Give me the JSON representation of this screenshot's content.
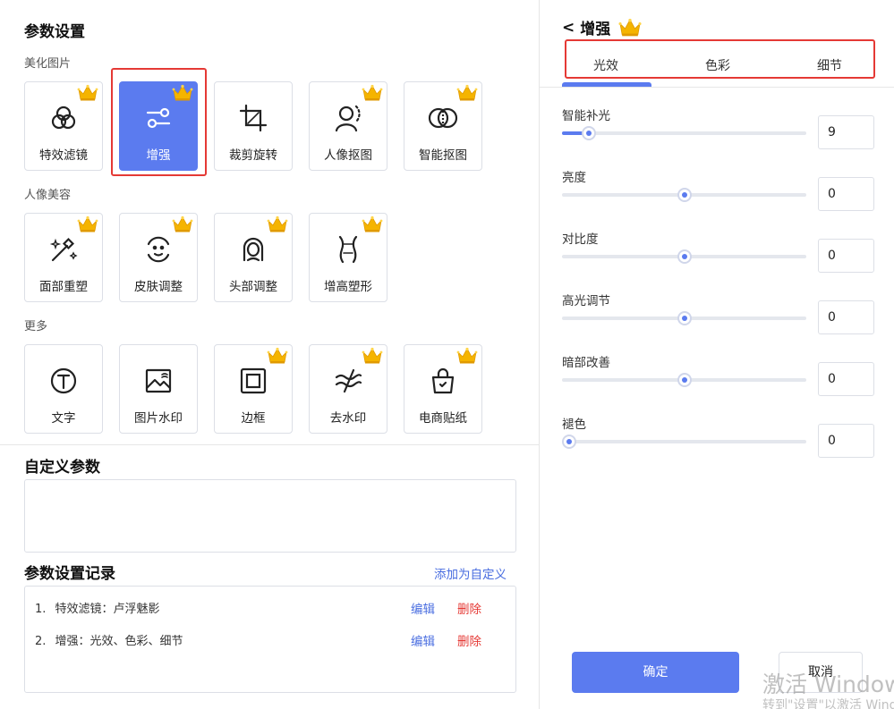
{
  "left": {
    "title": "参数设置",
    "sections": {
      "beautify": "美化图片",
      "portrait": "人像美容",
      "more": "更多"
    },
    "tiles": {
      "filter": "特效滤镜",
      "enhance": "增强",
      "crop": "裁剪旋转",
      "portrait_cutout": "人像抠图",
      "smart_cutout": "智能抠图",
      "face": "面部重塑",
      "skin": "皮肤调整",
      "head": "头部调整",
      "height": "增高塑形",
      "text": "文字",
      "image_watermark": "图片水印",
      "border": "边框",
      "remove_watermark": "去水印",
      "ecommerce_sticker": "电商贴纸"
    },
    "custom_title": "自定义参数",
    "records_title": "参数设置记录",
    "add_custom": "添加为自定义",
    "records": [
      {
        "index": "1.",
        "text": "特效滤镜：卢浮魅影",
        "edit": "编辑",
        "delete": "删除"
      },
      {
        "index": "2.",
        "text": "增强：光效、色彩、细节",
        "edit": "编辑",
        "delete": "删除"
      }
    ]
  },
  "right": {
    "back": "<",
    "title": "增强",
    "tabs": [
      "光效",
      "色彩",
      "细节"
    ],
    "sliders": [
      {
        "label": "智能补光",
        "value": "9",
        "fraction": 0.11
      },
      {
        "label": "亮度",
        "value": "0",
        "fraction": 0.5
      },
      {
        "label": "对比度",
        "value": "0",
        "fraction": 0.5
      },
      {
        "label": "高光调节",
        "value": "0",
        "fraction": 0.5
      },
      {
        "label": "暗部改善",
        "value": "0",
        "fraction": 0.5
      },
      {
        "label": "褪色",
        "value": "0",
        "fraction": 0.03
      }
    ],
    "confirm": "确定",
    "cancel": "取消"
  },
  "watermark": {
    "line1": "激活 Windows",
    "line2": "转到\"设置\"以激活 Windows。"
  },
  "colors": {
    "accent": "#5b7bef",
    "danger": "#e53935",
    "link": "#4a6ee0",
    "crown": "#f5b400"
  }
}
